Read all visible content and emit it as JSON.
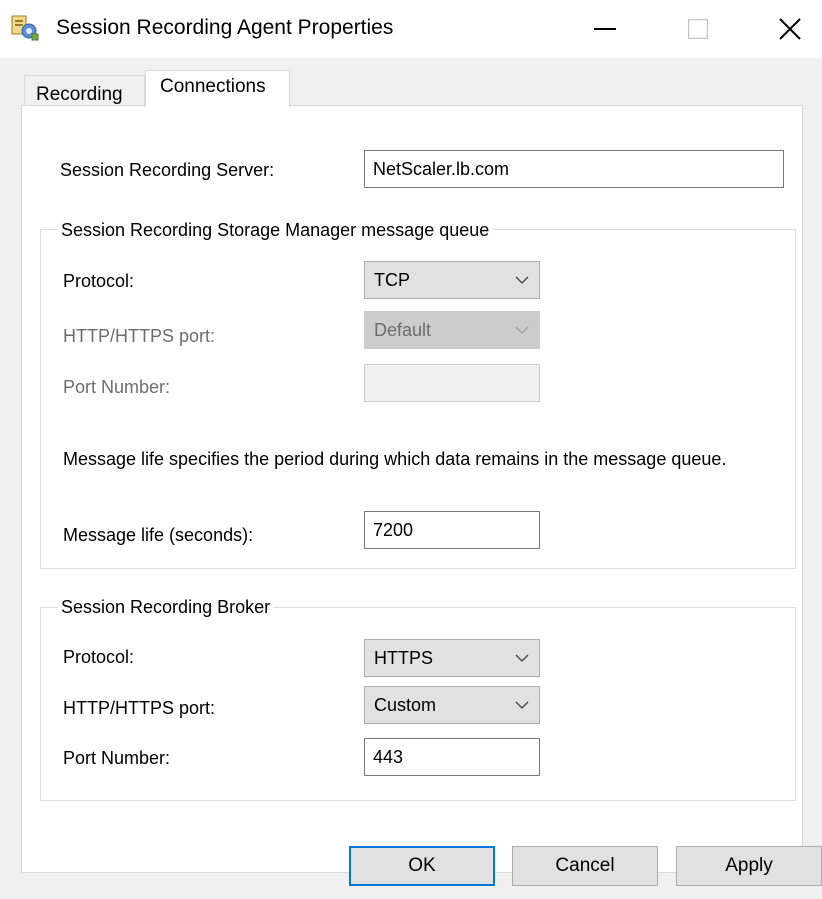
{
  "window": {
    "title": "Session Recording Agent Properties",
    "icon": "session-recording-agent-icon"
  },
  "tabs": [
    {
      "label": "Recording",
      "selected": false
    },
    {
      "label": "Connections",
      "selected": true
    }
  ],
  "server": {
    "label": "Session Recording Server:",
    "value": "NetScaler.lb.com"
  },
  "queue_group": {
    "title": "Session Recording Storage Manager message queue",
    "protocol_label": "Protocol:",
    "protocol_value": "TCP",
    "port_label": "HTTP/HTTPS port:",
    "port_value": "Default",
    "port_number_label": "Port Number:",
    "port_number_value": "",
    "description": "Message life specifies the period during which data remains in the message queue.",
    "message_life_label": "Message life (seconds):",
    "message_life_value": "7200"
  },
  "broker_group": {
    "title": "Session Recording Broker",
    "protocol_label": "Protocol:",
    "protocol_value": "HTTPS",
    "port_label": "HTTP/HTTPS port:",
    "port_value": "Custom",
    "port_number_label": "Port Number:",
    "port_number_value": "443"
  },
  "buttons": {
    "ok": "OK",
    "cancel": "Cancel",
    "apply": "Apply"
  },
  "colors": {
    "default_button_border": "#0078d7",
    "dialog_background": "#f0f0f0",
    "disabled_text": "#6d6d6d"
  }
}
